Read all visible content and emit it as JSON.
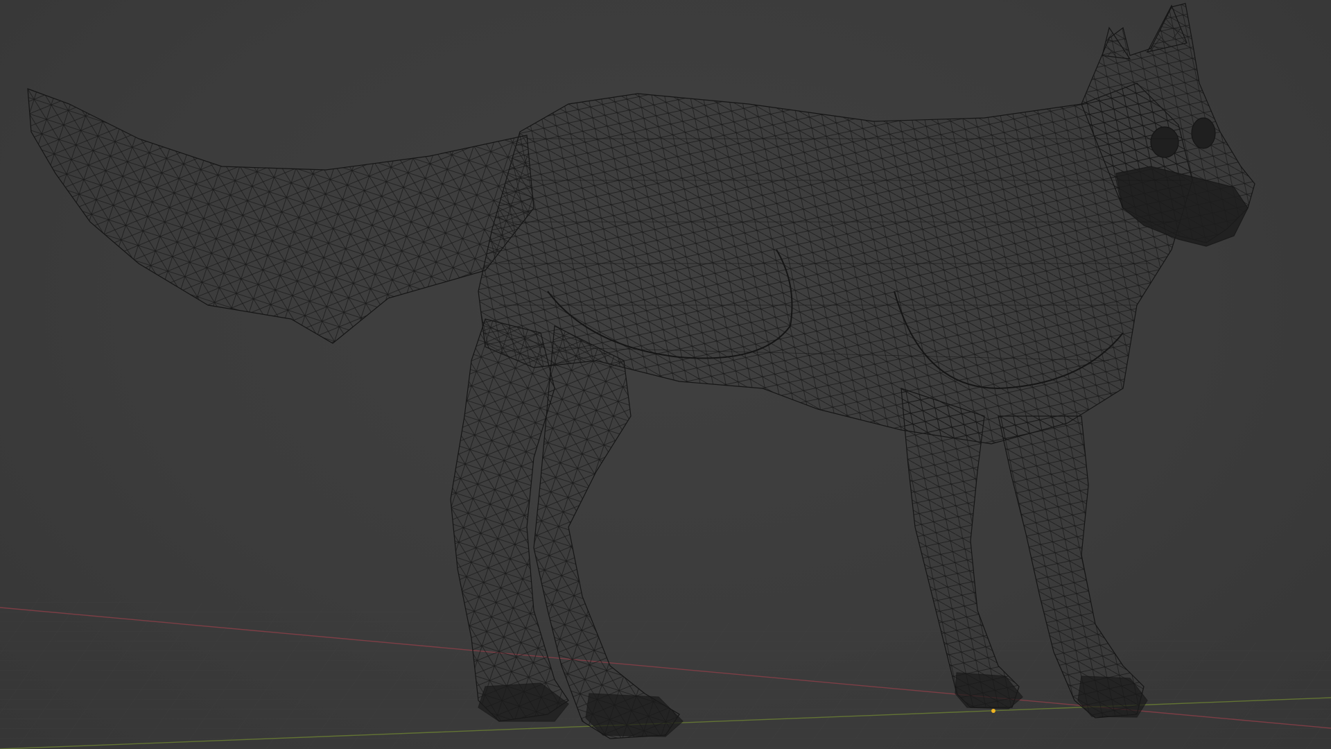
{
  "app": {
    "name": "3D viewport",
    "shading_mode": "wireframe"
  },
  "scene": {
    "object": "wolf-mesh",
    "colors": {
      "background": "#3d3d3d",
      "wire": "#141414",
      "floor_grid": "#444444",
      "x_axis": "#8a3f48",
      "y_axis": "#6b7f33",
      "origin": "#f0b422"
    }
  }
}
